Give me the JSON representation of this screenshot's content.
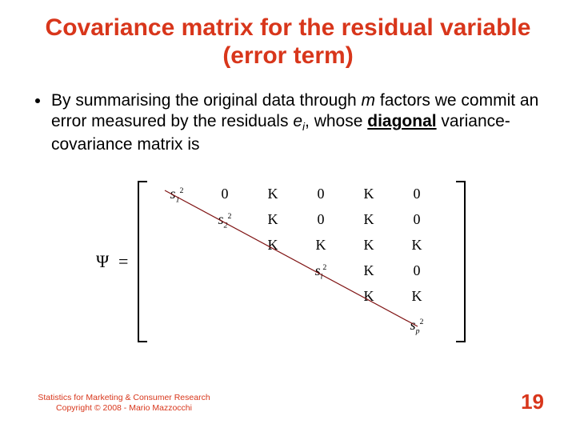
{
  "title": "Covariance matrix for the residual variable (error term)",
  "bullet": {
    "pre": "By summarising the original data through ",
    "m": "m",
    "mid1": " factors we commit an error measured by the residuals ",
    "e": "e",
    "esub": "i",
    "mid2": ", whose ",
    "diag": "diagonal",
    "post": " variance-covariance matrix is"
  },
  "matrix": {
    "psi": "Ψ",
    "eq": "=",
    "s": "s",
    "sq": "2",
    "sub1": "1",
    "sub2": "2",
    "subi": "i",
    "subp": "p",
    "zero": "0",
    "K": "K"
  },
  "footer": {
    "line1": "Statistics for Marketing & Consumer Research",
    "line2": "Copyright © 2008 - Mario Mazzocchi"
  },
  "page": "19"
}
